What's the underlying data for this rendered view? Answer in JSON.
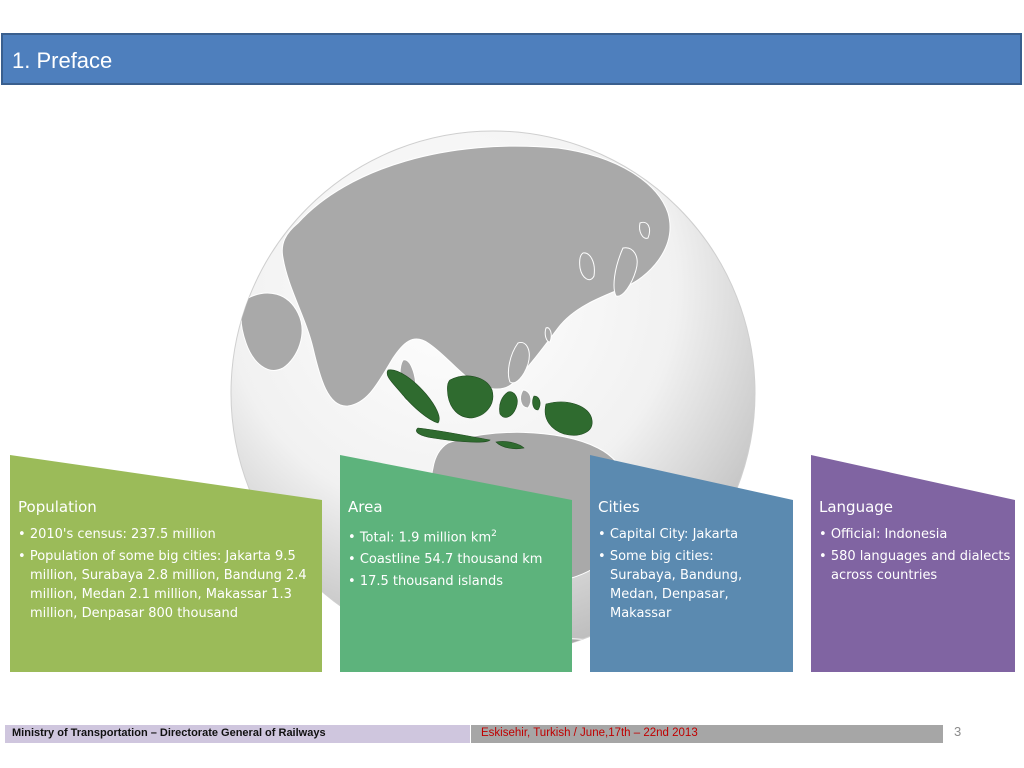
{
  "slide": {
    "title": "1. Preface",
    "page_number": "3"
  },
  "panels": [
    {
      "heading": "Population",
      "color": "#9bbb59",
      "bullets": [
        "2010's census: 237.5 million",
        "Population of some big cities: Jakarta 9.5 million,  Surabaya 2.8 million, Bandung 2.4 million,  Medan 2.1 million, Makassar 1.3 million, Denpasar 800 thousand"
      ]
    },
    {
      "heading": "Area",
      "color": "#5db37c",
      "bullets": [
        "Total: 1.9 million km",
        "Coastline 54.7 thousand km",
        "17.5 thousand islands"
      ],
      "area_superscript": "2"
    },
    {
      "heading": "Cities",
      "color": "#5b8ab0",
      "bullets": [
        "Capital City: Jakarta",
        "Some big cities: Surabaya, Bandung, Medan, Denpasar, Makassar"
      ]
    },
    {
      "heading": "Language",
      "color": "#8064a2",
      "bullets": [
        "Official: Indonesia",
        "580 languages and dialects across  countries"
      ]
    }
  ],
  "footer": {
    "left_text": "Ministry of Transportation – Directorate General of Railways",
    "right_text": "Eskisehir, Turkish / June,17th – 22nd 2013"
  },
  "colors": {
    "title_bar": "#4e7fbd",
    "globe_land": "#a9a9a9",
    "indonesia_highlight": "#2f6b2f",
    "footer_left_bg": "#cfc6de",
    "footer_right_bg": "#a6a6a6",
    "footer_right_text": "#c00000"
  }
}
